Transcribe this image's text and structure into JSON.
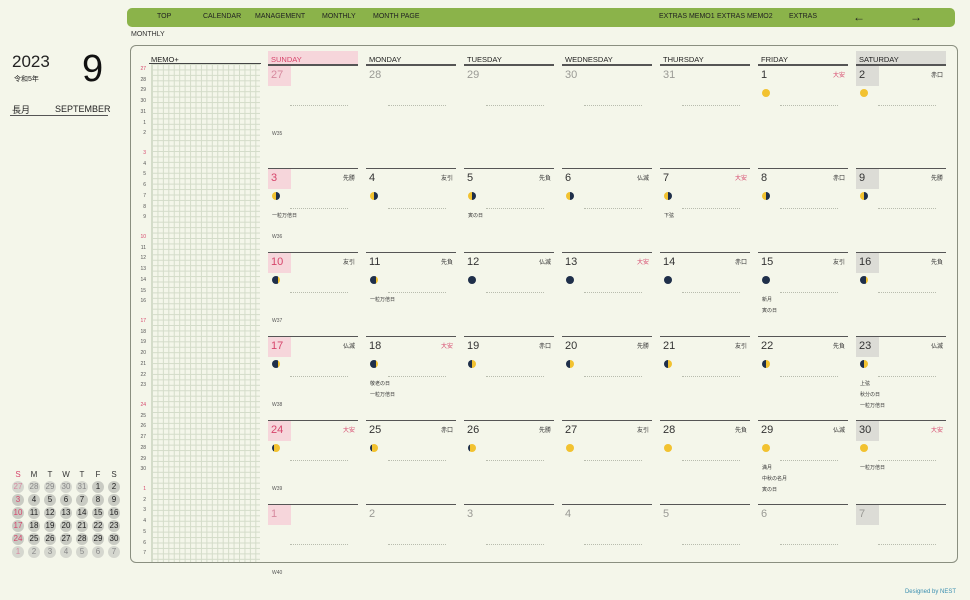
{
  "nav": {
    "items": [
      "TOP",
      "CALENDAR",
      "MANAGEMENT",
      "MONTHLY",
      "MONTH PAGE",
      "EXTRAS MEMO1",
      "EXTRAS MEMO2",
      "EXTRAS"
    ],
    "prev_arrow": "←",
    "next_arrow": "→"
  },
  "section_label": "MONTHLY",
  "header": {
    "year": "2023",
    "era": "令和5年",
    "month_number": "9",
    "jp_month": "長月",
    "en_month": "SEPTEMBER"
  },
  "memo": {
    "title": "MEMO+",
    "row_numbers": [
      [
        "27",
        "28",
        "29",
        "30",
        "31",
        "1",
        "2"
      ],
      [
        "3",
        "4",
        "5",
        "6",
        "7",
        "8",
        "9"
      ],
      [
        "10",
        "11",
        "12",
        "13",
        "14",
        "15",
        "16"
      ],
      [
        "17",
        "18",
        "19",
        "20",
        "21",
        "22",
        "23"
      ],
      [
        "24",
        "25",
        "26",
        "27",
        "28",
        "29",
        "30"
      ],
      [
        "1",
        "2",
        "3",
        "4",
        "5",
        "6",
        "7"
      ]
    ]
  },
  "day_headers": [
    "SUNDAY",
    "MONDAY",
    "TUESDAY",
    "WEDNESDAY",
    "THURSDAY",
    "FRIDAY",
    "SATURDAY"
  ],
  "weeks": [
    {
      "label": "W35",
      "days": [
        {
          "n": "27",
          "dim": true
        },
        {
          "n": "28",
          "dim": true
        },
        {
          "n": "29",
          "dim": true
        },
        {
          "n": "30",
          "dim": true
        },
        {
          "n": "31",
          "dim": true
        },
        {
          "n": "1",
          "r": "大安",
          "rred": true,
          "moon": "full",
          "events": []
        },
        {
          "n": "2",
          "r": "赤口",
          "moon": "full",
          "events": []
        }
      ]
    },
    {
      "label": "W36",
      "days": [
        {
          "n": "3",
          "r": "先勝",
          "moon": "waning",
          "events": [
            "一粒万倍日"
          ]
        },
        {
          "n": "4",
          "r": "友引",
          "moon": "waning",
          "events": []
        },
        {
          "n": "5",
          "r": "先負",
          "moon": "waning",
          "events": [
            "寅の日"
          ]
        },
        {
          "n": "6",
          "r": "仏滅",
          "moon": "waning",
          "events": []
        },
        {
          "n": "7",
          "r": "大安",
          "rred": true,
          "moon": "waning",
          "events": [
            "下弦"
          ]
        },
        {
          "n": "8",
          "r": "赤口",
          "moon": "waning",
          "events": []
        },
        {
          "n": "9",
          "r": "先勝",
          "moon": "waning",
          "events": []
        }
      ]
    },
    {
      "label": "W37",
      "days": [
        {
          "n": "10",
          "r": "友引",
          "moon": "crescent",
          "events": []
        },
        {
          "n": "11",
          "r": "先負",
          "moon": "crescent",
          "events": [
            "一粒万倍日"
          ]
        },
        {
          "n": "12",
          "r": "仏滅",
          "moon": "new",
          "events": []
        },
        {
          "n": "13",
          "r": "大安",
          "rred": true,
          "moon": "new",
          "events": []
        },
        {
          "n": "14",
          "r": "赤口",
          "moon": "new",
          "events": []
        },
        {
          "n": "15",
          "r": "友引",
          "moon": "new",
          "events": [
            "新月",
            "寅の日"
          ]
        },
        {
          "n": "16",
          "r": "先負",
          "moon": "crescent",
          "events": []
        }
      ]
    },
    {
      "label": "W38",
      "days": [
        {
          "n": "17",
          "r": "仏滅",
          "moon": "crescent",
          "events": []
        },
        {
          "n": "18",
          "r": "大安",
          "rred": true,
          "moon": "crescent",
          "events": [
            "敬老の日",
            "一粒万倍日"
          ]
        },
        {
          "n": "19",
          "r": "赤口",
          "moon": "waxing",
          "events": []
        },
        {
          "n": "20",
          "r": "先勝",
          "moon": "waxing",
          "events": []
        },
        {
          "n": "21",
          "r": "友引",
          "moon": "waxing",
          "events": []
        },
        {
          "n": "22",
          "r": "先負",
          "moon": "waxing",
          "events": []
        },
        {
          "n": "23",
          "r": "仏滅",
          "moon": "waxing",
          "events": [
            "上弦",
            "秋分の日",
            "一粒万倍日"
          ]
        }
      ]
    },
    {
      "label": "W39",
      "days": [
        {
          "n": "24",
          "r": "大安",
          "rred": true,
          "moon": "gibbous",
          "events": []
        },
        {
          "n": "25",
          "r": "赤口",
          "moon": "gibbous",
          "events": []
        },
        {
          "n": "26",
          "r": "先勝",
          "moon": "gibbous",
          "events": []
        },
        {
          "n": "27",
          "r": "友引",
          "moon": "full",
          "events": []
        },
        {
          "n": "28",
          "r": "先負",
          "moon": "full",
          "events": []
        },
        {
          "n": "29",
          "r": "仏滅",
          "moon": "full",
          "events": [
            "満月",
            "中秋の名月",
            "寅の日"
          ]
        },
        {
          "n": "30",
          "r": "大安",
          "rred": true,
          "moon": "full",
          "events": [
            "一粒万倍日"
          ]
        }
      ]
    },
    {
      "label": "W40",
      "days": [
        {
          "n": "1",
          "dim": true
        },
        {
          "n": "2",
          "dim": true
        },
        {
          "n": "3",
          "dim": true
        },
        {
          "n": "4",
          "dim": true
        },
        {
          "n": "5",
          "dim": true
        },
        {
          "n": "6",
          "dim": true
        },
        {
          "n": "7",
          "dim": true
        }
      ]
    }
  ],
  "mini_calendar": {
    "headers": [
      "S",
      "M",
      "T",
      "W",
      "T",
      "F",
      "S"
    ],
    "rows": [
      [
        {
          "n": "27",
          "dim": true
        },
        {
          "n": "28",
          "dim": true
        },
        {
          "n": "29",
          "dim": true
        },
        {
          "n": "30",
          "dim": true
        },
        {
          "n": "31",
          "dim": true
        },
        {
          "n": "1"
        },
        {
          "n": "2"
        }
      ],
      [
        {
          "n": "3"
        },
        {
          "n": "4"
        },
        {
          "n": "5"
        },
        {
          "n": "6"
        },
        {
          "n": "7"
        },
        {
          "n": "8"
        },
        {
          "n": "9"
        }
      ],
      [
        {
          "n": "10"
        },
        {
          "n": "11"
        },
        {
          "n": "12"
        },
        {
          "n": "13"
        },
        {
          "n": "14"
        },
        {
          "n": "15"
        },
        {
          "n": "16"
        }
      ],
      [
        {
          "n": "17"
        },
        {
          "n": "18"
        },
        {
          "n": "19"
        },
        {
          "n": "20"
        },
        {
          "n": "21"
        },
        {
          "n": "22"
        },
        {
          "n": "23"
        }
      ],
      [
        {
          "n": "24"
        },
        {
          "n": "25"
        },
        {
          "n": "26"
        },
        {
          "n": "27"
        },
        {
          "n": "28"
        },
        {
          "n": "29"
        },
        {
          "n": "30"
        }
      ],
      [
        {
          "n": "1",
          "dim": true
        },
        {
          "n": "2",
          "dim": true
        },
        {
          "n": "3",
          "dim": true
        },
        {
          "n": "4",
          "dim": true
        },
        {
          "n": "5",
          "dim": true
        },
        {
          "n": "6",
          "dim": true
        },
        {
          "n": "7",
          "dim": true
        }
      ]
    ]
  },
  "colors": {
    "nav_bg": "#8bb34a",
    "sunday_accent": "#d6456b",
    "sunday_bg": "#f6d6db",
    "saturday_bg": "#dcdcd6",
    "page_bg": "#f4f6ea"
  },
  "credit": "Designed by NEST"
}
